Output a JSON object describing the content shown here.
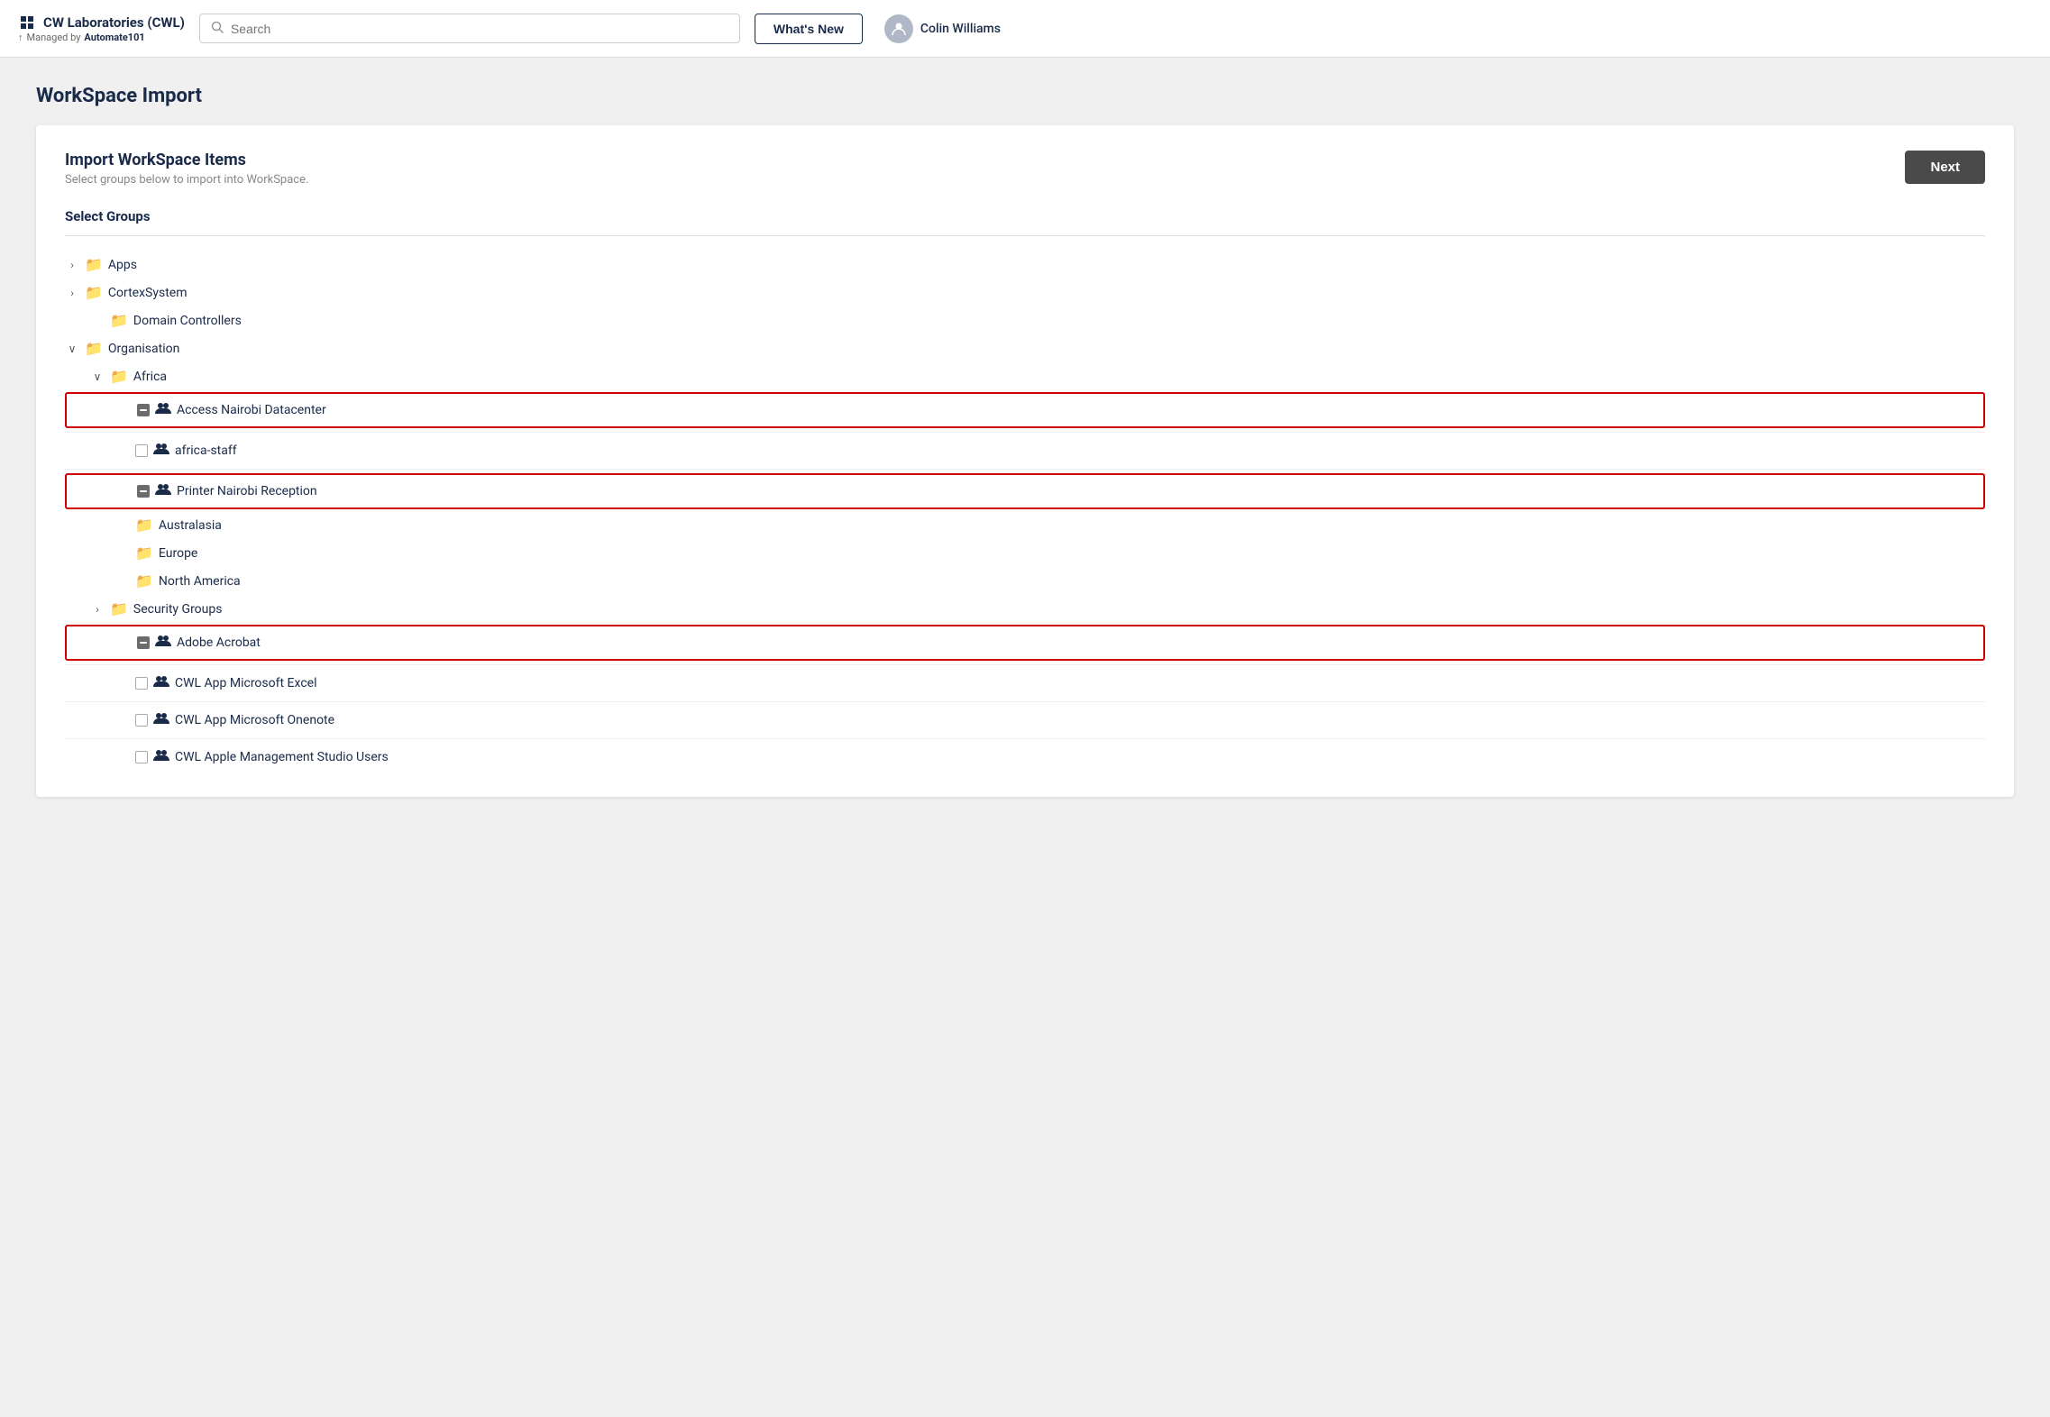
{
  "header": {
    "brand_title": "CW Laboratories (CWL)",
    "brand_subtitle_prefix": "Managed by",
    "brand_subtitle_name": "Automate101",
    "search_placeholder": "Search",
    "whats_new_label": "What's New",
    "user_name": "Colin Williams"
  },
  "page": {
    "title": "WorkSpace Import",
    "card": {
      "heading": "Import WorkSpace Items",
      "description": "Select groups below to import into WorkSpace.",
      "next_label": "Next",
      "groups_section_label": "Select Groups"
    }
  },
  "tree": {
    "items": [
      {
        "id": "apps",
        "label": "Apps",
        "type": "folder",
        "level": 0,
        "chevron": "right",
        "chevron_state": "collapsed"
      },
      {
        "id": "cortexsystem",
        "label": "CortexSystem",
        "type": "folder",
        "level": 0,
        "chevron": "right",
        "chevron_state": "collapsed"
      },
      {
        "id": "domain-controllers",
        "label": "Domain Controllers",
        "type": "folder",
        "level": 1,
        "chevron": "none"
      },
      {
        "id": "organisation",
        "label": "Organisation",
        "type": "folder",
        "level": 0,
        "chevron": "down",
        "chevron_state": "expanded"
      },
      {
        "id": "africa",
        "label": "Africa",
        "type": "folder",
        "level": 1,
        "chevron": "down",
        "chevron_state": "expanded"
      },
      {
        "id": "access-nairobi",
        "label": "Access Nairobi Datacenter",
        "type": "group",
        "level": 2,
        "checkbox": "indeterminate",
        "highlighted": true
      },
      {
        "id": "africa-staff",
        "label": "africa-staff",
        "type": "group",
        "level": 2,
        "checkbox": "unchecked",
        "highlighted": false
      },
      {
        "id": "printer-nairobi",
        "label": "Printer Nairobi Reception",
        "type": "group",
        "level": 2,
        "checkbox": "indeterminate",
        "highlighted": true
      },
      {
        "id": "australasia",
        "label": "Australasia",
        "type": "folder",
        "level": 2,
        "chevron": "none"
      },
      {
        "id": "europe",
        "label": "Europe",
        "type": "folder",
        "level": 2,
        "chevron": "none"
      },
      {
        "id": "north-america",
        "label": "North America",
        "type": "folder",
        "level": 2,
        "chevron": "none"
      },
      {
        "id": "security-groups",
        "label": "Security Groups",
        "type": "folder",
        "level": 1,
        "chevron": "right",
        "chevron_state": "collapsed"
      },
      {
        "id": "adobe-acrobat",
        "label": "Adobe Acrobat",
        "type": "group",
        "level": 2,
        "checkbox": "indeterminate",
        "highlighted": true
      },
      {
        "id": "cwl-excel",
        "label": "CWL App Microsoft Excel",
        "type": "group",
        "level": 2,
        "checkbox": "unchecked",
        "highlighted": false
      },
      {
        "id": "cwl-onenote",
        "label": "CWL App Microsoft Onenote",
        "type": "group",
        "level": 2,
        "checkbox": "unchecked",
        "highlighted": false
      },
      {
        "id": "cwl-apple",
        "label": "CWL Apple Management Studio Users",
        "type": "group",
        "level": 2,
        "checkbox": "unchecked",
        "highlighted": false
      }
    ]
  }
}
